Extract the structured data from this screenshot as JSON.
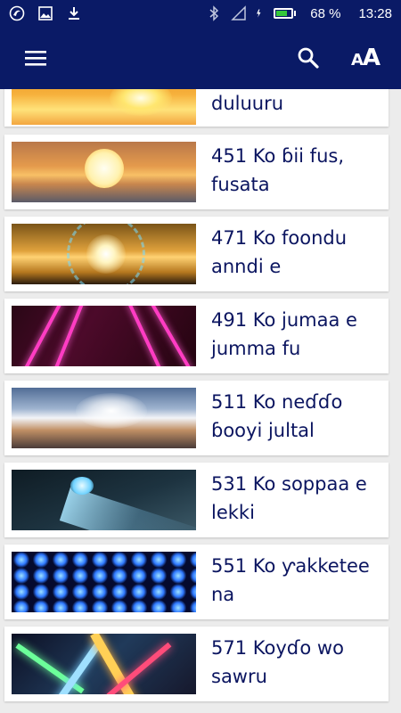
{
  "status_bar": {
    "battery": "68 %",
    "time": "13:28",
    "icons": [
      "app-notification-icon",
      "image-icon",
      "download-icon",
      "bluetooth-icon",
      "signal-icon",
      "charging-icon",
      "battery-icon"
    ]
  },
  "app_bar": {
    "icons": [
      "menu-icon",
      "search-icon",
      "font-size-icon"
    ],
    "color": "#0a1a66"
  },
  "items": [
    {
      "title": "duluuru",
      "image": "sun-glow-icon"
    },
    {
      "title": "451 Ko ɓii fus, fusata",
      "image": "sunset-icon"
    },
    {
      "title": "471 Ko foondu anndi e",
      "image": "starburst-icon"
    },
    {
      "title": "491 Ko jumaa e jumma fu",
      "image": "laser-beams-icon"
    },
    {
      "title": "511 Ko neɗɗo ɓooyi jultal",
      "image": "cloud-light-icon"
    },
    {
      "title": "531 Ko soppaa e lekki",
      "image": "flashlight-icon"
    },
    {
      "title": "551 Ko ƴakketee na",
      "image": "led-lights-icon"
    },
    {
      "title": "571 Koyɗo wo sawru",
      "image": "prism-light-icon"
    }
  ],
  "colors": {
    "title_text": "#0b1560",
    "background": "#ececec"
  }
}
